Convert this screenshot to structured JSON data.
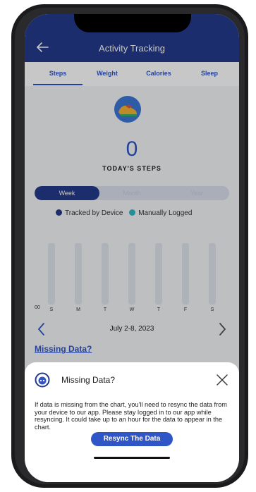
{
  "header": {
    "back_icon": "arrow-left-icon",
    "title": "Activity Tracking"
  },
  "tabs": [
    {
      "label": "Steps",
      "active": true
    },
    {
      "label": "Weight",
      "active": false
    },
    {
      "label": "Calories",
      "active": false
    },
    {
      "label": "Sleep",
      "active": false
    }
  ],
  "summary": {
    "icon": "sneaker-icon",
    "value": "0",
    "label": "TODAY'S STEPS"
  },
  "period_toggle": [
    {
      "label": "Week",
      "active": true
    },
    {
      "label": "Month",
      "active": false
    },
    {
      "label": "Year",
      "active": false
    }
  ],
  "legend": {
    "tracked": {
      "label": "Tracked by Device",
      "color": "#233a8c"
    },
    "manual": {
      "label": "Manually Logged",
      "color": "#2fb8c4"
    }
  },
  "chart_data": {
    "type": "bar",
    "categories": [
      "S",
      "M",
      "T",
      "W",
      "T",
      "F",
      "S"
    ],
    "series": [
      {
        "name": "Tracked by Device",
        "values": [
          0,
          0,
          0,
          0,
          0,
          0,
          0
        ]
      },
      {
        "name": "Manually Logged",
        "values": [
          0,
          0,
          0,
          0,
          0,
          0,
          0
        ]
      }
    ],
    "y_tick": "00"
  },
  "date_nav": {
    "label": "July 2-8, 2023",
    "prev_icon": "chevron-left-icon",
    "next_icon": "chevron-right-icon"
  },
  "missing_link": "Missing Data?",
  "sheet": {
    "icon": "chat-bot-icon",
    "title": "Missing Data?",
    "close_icon": "close-icon",
    "body": "If data is missing from the chart, you'll need to resync the data from your device to our app. Please stay logged in to our app while resyncing. It could take up to an hour for the data to appear in the chart.",
    "button": "Resync The Data"
  },
  "colors": {
    "primary": "#233a8c",
    "accent": "#2f55c6",
    "teal": "#2fb8c4"
  }
}
